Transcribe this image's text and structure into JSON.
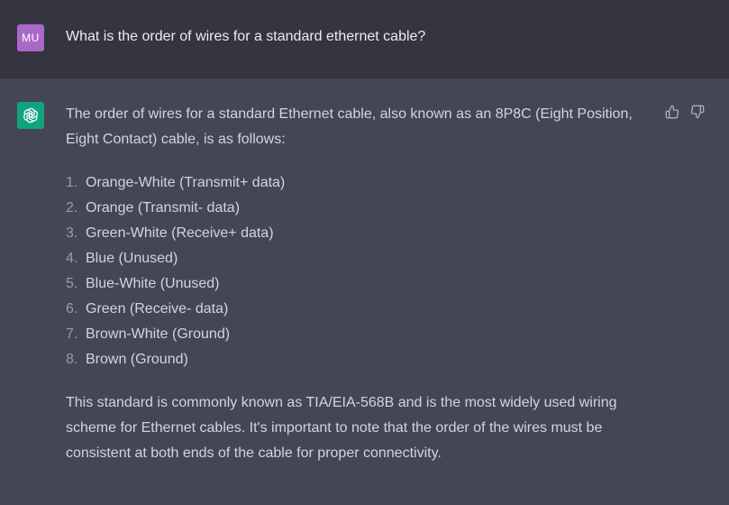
{
  "user_message": {
    "avatar_initials": "MU",
    "text": "What is the order of wires for a standard ethernet cable?"
  },
  "assistant_message": {
    "avatar_icon": "openai-logo-icon",
    "intro": "The order of wires for a standard Ethernet cable, also known as an 8P8C (Eight Position, Eight Contact) cable, is as follows:",
    "list": [
      {
        "num": "1.",
        "text": "Orange-White (Transmit+ data)"
      },
      {
        "num": "2.",
        "text": "Orange (Transmit- data)"
      },
      {
        "num": "3.",
        "text": "Green-White (Receive+ data)"
      },
      {
        "num": "4.",
        "text": "Blue (Unused)"
      },
      {
        "num": "5.",
        "text": "Blue-White (Unused)"
      },
      {
        "num": "6.",
        "text": "Green (Receive- data)"
      },
      {
        "num": "7.",
        "text": "Brown-White (Ground)"
      },
      {
        "num": "8.",
        "text": "Brown (Ground)"
      }
    ],
    "outro": "This standard is commonly known as TIA/EIA-568B and is the most widely used wiring scheme for Ethernet cables. It's important to note that the order of the wires must be consistent at both ends of the cable for proper connectivity."
  },
  "feedback": {
    "up_icon": "thumbs-up-icon",
    "down_icon": "thumbs-down-icon"
  },
  "colors": {
    "user_bg": "#343541",
    "assistant_bg": "#444654",
    "user_avatar": "#ab68c6",
    "bot_avatar": "#10a37f"
  }
}
